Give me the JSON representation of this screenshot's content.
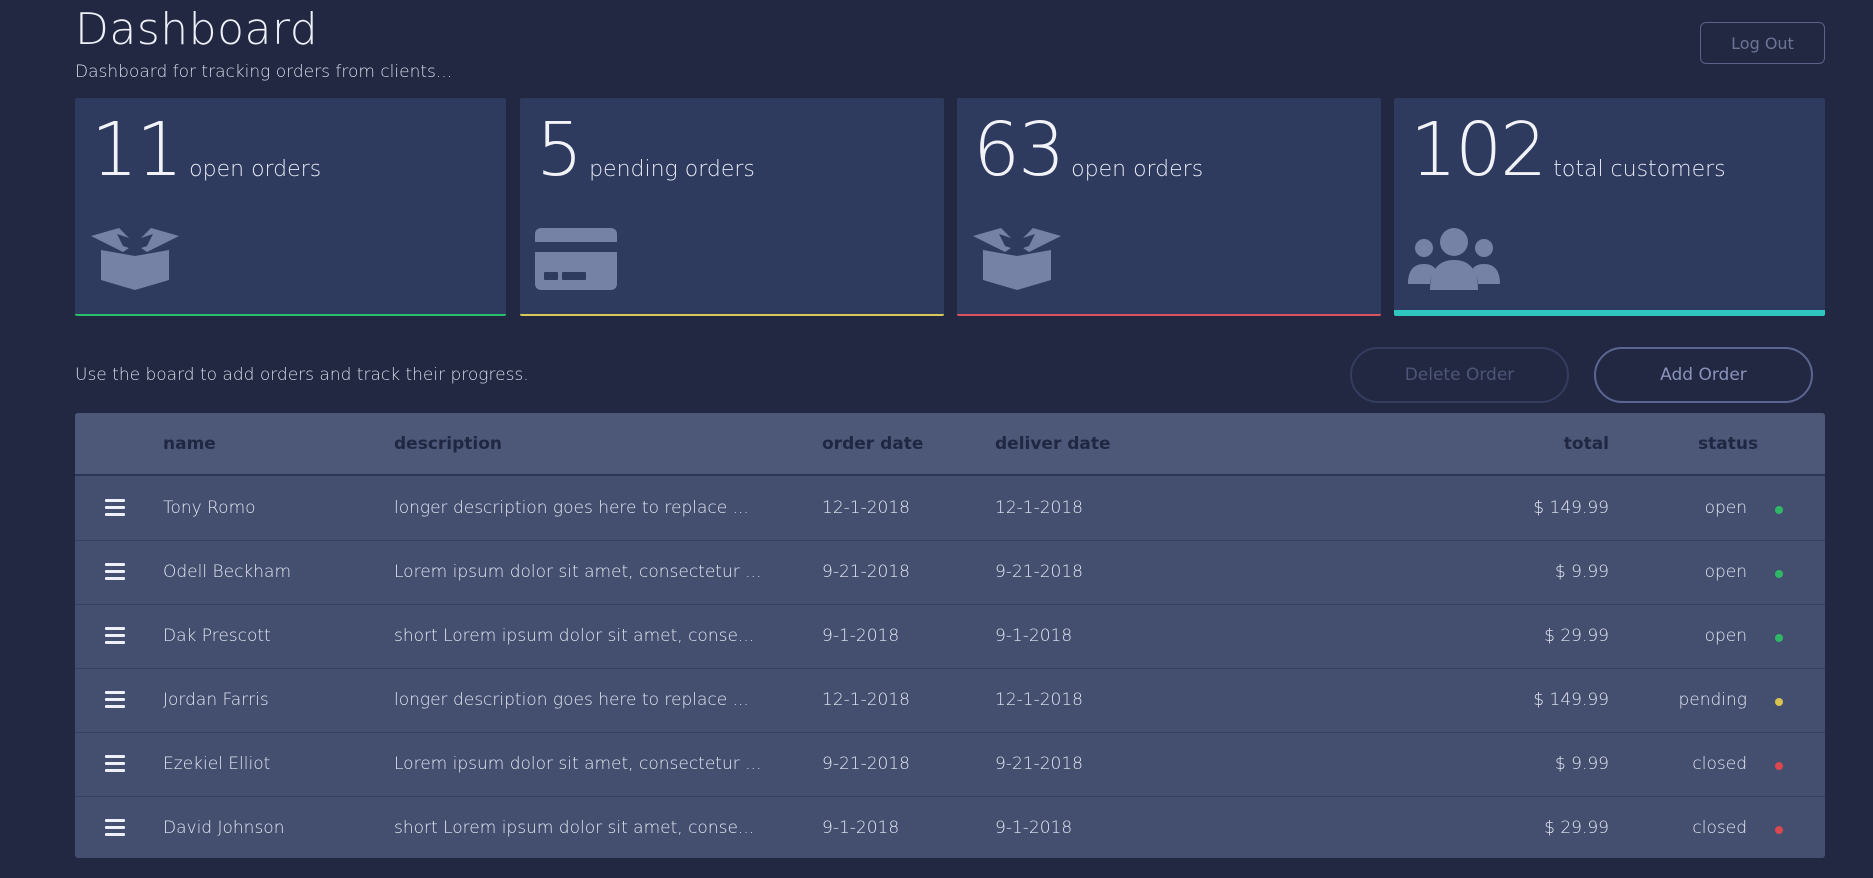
{
  "header": {
    "title": "Dashboard",
    "subtitle": "Dashboard for tracking orders from clients...",
    "logout_label": "Log Out"
  },
  "cards": [
    {
      "number": "11",
      "label": "open orders",
      "icon": "box-open-icon",
      "accent": "#28c06a"
    },
    {
      "number": "5",
      "label": "pending orders",
      "icon": "credit-card-icon",
      "accent": "#d9c75a"
    },
    {
      "number": "63",
      "label": "open orders",
      "icon": "box-open-icon",
      "accent": "#d9545e"
    },
    {
      "number": "102",
      "label": "total customers",
      "icon": "users-icon",
      "accent": "#2fc6c0"
    }
  ],
  "intro": "Use the board to add orders and track their progress.",
  "actions": {
    "delete_label": "Delete Order",
    "add_label": "Add Order"
  },
  "table": {
    "columns": {
      "name": "name",
      "description": "description",
      "order_date": "order date",
      "deliver_date": "deliver date",
      "total": "total",
      "status": "status"
    },
    "rows": [
      {
        "name": "Tony Romo",
        "description": "longer description goes here to replace ...",
        "order_date": "12-1-2018",
        "deliver_date": "12-1-2018",
        "total": "$ 149.99",
        "status": "open",
        "status_color": "#2fb766"
      },
      {
        "name": "Odell Beckham",
        "description": "Lorem ipsum dolor sit amet, consectetur ...",
        "order_date": "9-21-2018",
        "deliver_date": "9-21-2018",
        "total": "$ 9.99",
        "status": "open",
        "status_color": "#2fb766"
      },
      {
        "name": "Dak Prescott",
        "description": "short Lorem ipsum dolor sit amet, conse...",
        "order_date": "9-1-2018",
        "deliver_date": "9-1-2018",
        "total": "$ 29.99",
        "status": "open",
        "status_color": "#2fb766"
      },
      {
        "name": "Jordan Farris",
        "description": "longer description goes here to replace ...",
        "order_date": "12-1-2018",
        "deliver_date": "12-1-2018",
        "total": "$ 149.99",
        "status": "pending",
        "status_color": "#d8c351"
      },
      {
        "name": "Ezekiel Elliot",
        "description": "Lorem ipsum dolor sit amet, consectetur ...",
        "order_date": "9-21-2018",
        "deliver_date": "9-21-2018",
        "total": "$ 9.99",
        "status": "closed",
        "status_color": "#d9474f"
      },
      {
        "name": "David Johnson",
        "description": "short Lorem ipsum dolor sit amet, conse...",
        "order_date": "9-1-2018",
        "deliver_date": "9-1-2018",
        "total": "$ 29.99",
        "status": "closed",
        "status_color": "#d9474f"
      }
    ]
  }
}
